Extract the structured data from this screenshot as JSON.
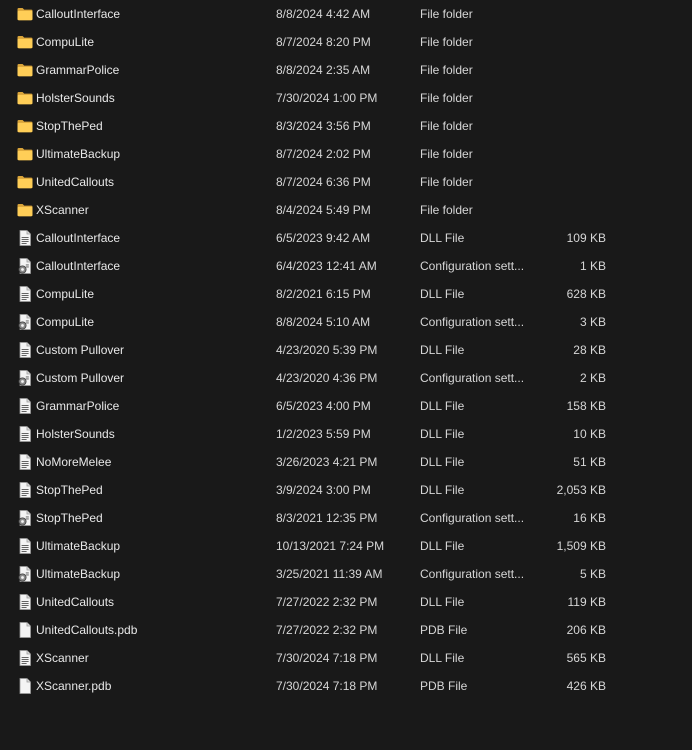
{
  "files": [
    {
      "name": "CalloutInterface",
      "date": "8/8/2024 4:42 AM",
      "type": "File folder",
      "size": "",
      "icon": "folder-icon"
    },
    {
      "name": "CompuLite",
      "date": "8/7/2024 8:20 PM",
      "type": "File folder",
      "size": "",
      "icon": "folder-icon"
    },
    {
      "name": "GrammarPolice",
      "date": "8/8/2024 2:35 AM",
      "type": "File folder",
      "size": "",
      "icon": "folder-icon"
    },
    {
      "name": "HolsterSounds",
      "date": "7/30/2024 1:00 PM",
      "type": "File folder",
      "size": "",
      "icon": "folder-icon"
    },
    {
      "name": "StopThePed",
      "date": "8/3/2024 3:56 PM",
      "type": "File folder",
      "size": "",
      "icon": "folder-icon"
    },
    {
      "name": "UltimateBackup",
      "date": "8/7/2024 2:02 PM",
      "type": "File folder",
      "size": "",
      "icon": "folder-icon"
    },
    {
      "name": "UnitedCallouts",
      "date": "8/7/2024 6:36 PM",
      "type": "File folder",
      "size": "",
      "icon": "folder-icon"
    },
    {
      "name": "XScanner",
      "date": "8/4/2024 5:49 PM",
      "type": "File folder",
      "size": "",
      "icon": "folder-icon"
    },
    {
      "name": "CalloutInterface",
      "date": "6/5/2023 9:42 AM",
      "type": "DLL File",
      "size": "109 KB",
      "icon": "dll-file-icon"
    },
    {
      "name": "CalloutInterface",
      "date": "6/4/2023 12:41 AM",
      "type": "Configuration sett...",
      "size": "1 KB",
      "icon": "config-file-icon"
    },
    {
      "name": "CompuLite",
      "date": "8/2/2021 6:15 PM",
      "type": "DLL File",
      "size": "628 KB",
      "icon": "dll-file-icon"
    },
    {
      "name": "CompuLite",
      "date": "8/8/2024 5:10 AM",
      "type": "Configuration sett...",
      "size": "3 KB",
      "icon": "config-file-icon"
    },
    {
      "name": "Custom Pullover",
      "date": "4/23/2020 5:39 PM",
      "type": "DLL File",
      "size": "28 KB",
      "icon": "dll-file-icon"
    },
    {
      "name": "Custom Pullover",
      "date": "4/23/2020 4:36 PM",
      "type": "Configuration sett...",
      "size": "2 KB",
      "icon": "config-file-icon"
    },
    {
      "name": "GrammarPolice",
      "date": "6/5/2023 4:00 PM",
      "type": "DLL File",
      "size": "158 KB",
      "icon": "dll-file-icon"
    },
    {
      "name": "HolsterSounds",
      "date": "1/2/2023 5:59 PM",
      "type": "DLL File",
      "size": "10 KB",
      "icon": "dll-file-icon"
    },
    {
      "name": "NoMoreMelee",
      "date": "3/26/2023 4:21 PM",
      "type": "DLL File",
      "size": "51 KB",
      "icon": "dll-file-icon"
    },
    {
      "name": "StopThePed",
      "date": "3/9/2024 3:00 PM",
      "type": "DLL File",
      "size": "2,053 KB",
      "icon": "dll-file-icon"
    },
    {
      "name": "StopThePed",
      "date": "8/3/2021 12:35 PM",
      "type": "Configuration sett...",
      "size": "16 KB",
      "icon": "config-file-icon"
    },
    {
      "name": "UltimateBackup",
      "date": "10/13/2021 7:24 PM",
      "type": "DLL File",
      "size": "1,509 KB",
      "icon": "dll-file-icon"
    },
    {
      "name": "UltimateBackup",
      "date": "3/25/2021 11:39 AM",
      "type": "Configuration sett...",
      "size": "5 KB",
      "icon": "config-file-icon"
    },
    {
      "name": "UnitedCallouts",
      "date": "7/27/2022 2:32 PM",
      "type": "DLL File",
      "size": "119 KB",
      "icon": "dll-file-icon"
    },
    {
      "name": "UnitedCallouts.pdb",
      "date": "7/27/2022 2:32 PM",
      "type": "PDB File",
      "size": "206 KB",
      "icon": "pdb-file-icon"
    },
    {
      "name": "XScanner",
      "date": "7/30/2024 7:18 PM",
      "type": "DLL File",
      "size": "565 KB",
      "icon": "dll-file-icon"
    },
    {
      "name": "XScanner.pdb",
      "date": "7/30/2024 7:18 PM",
      "type": "PDB File",
      "size": "426 KB",
      "icon": "pdb-file-icon"
    }
  ]
}
